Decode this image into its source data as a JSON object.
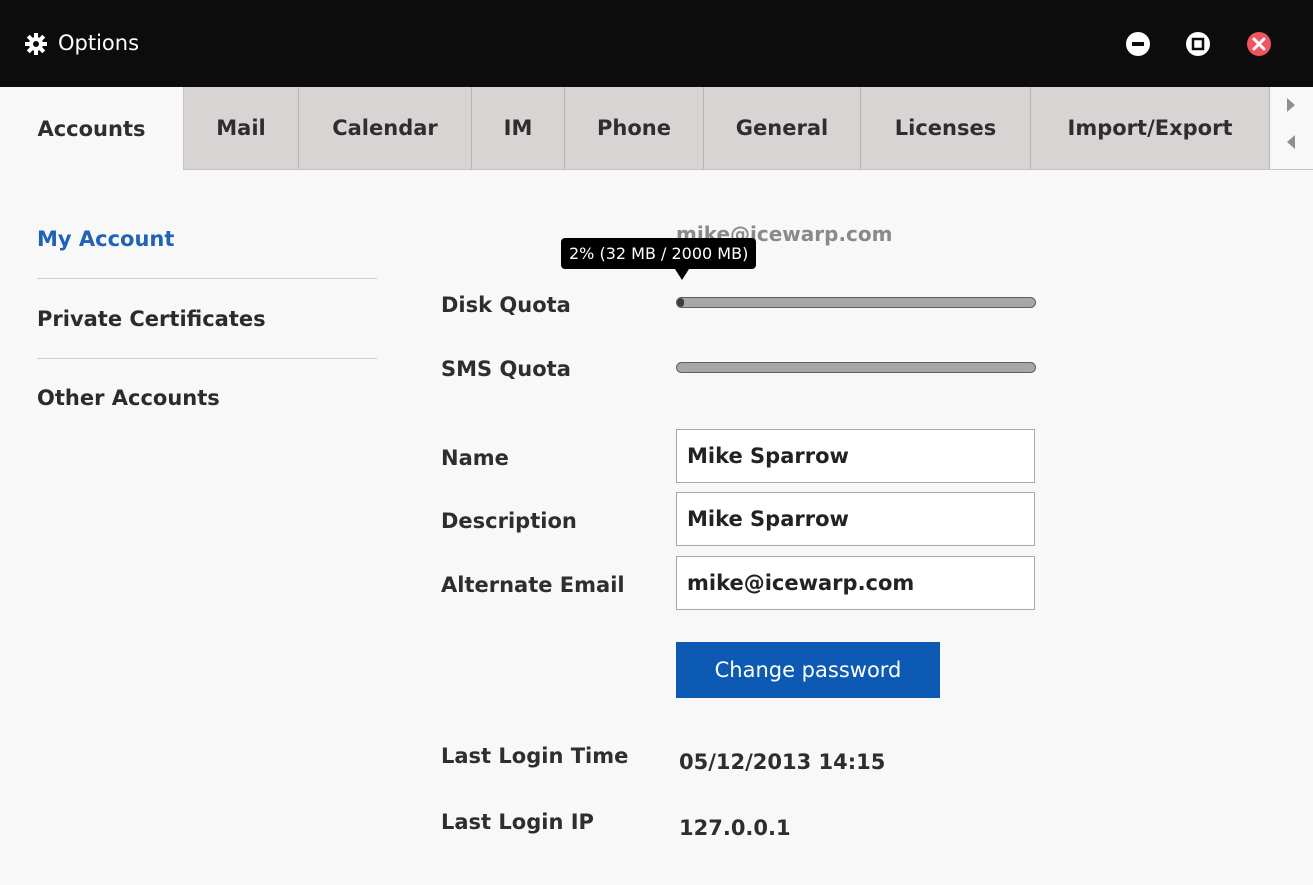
{
  "window": {
    "title": "Options",
    "icon": "gear-icon",
    "controls": [
      "minimize-icon",
      "maximize-icon",
      "close-icon"
    ],
    "close_color": "#f0545e"
  },
  "tabs": [
    {
      "label": "Accounts",
      "active": true
    },
    {
      "label": "Mail"
    },
    {
      "label": "Calendar"
    },
    {
      "label": "IM"
    },
    {
      "label": "Phone"
    },
    {
      "label": "General"
    },
    {
      "label": "Licenses"
    },
    {
      "label": "Import/Export"
    }
  ],
  "sidebar": {
    "items": [
      {
        "label": "My Account",
        "active": true
      },
      {
        "label": "Private Certificates"
      },
      {
        "label": "Other Accounts"
      }
    ]
  },
  "account": {
    "email_heading": "mike@icewarp.com",
    "disk_quota": {
      "label": "Disk Quota",
      "tooltip": "2% (32 MB / 2000 MB)",
      "used_fraction": 0.02
    },
    "sms_quota": {
      "label": "SMS Quota",
      "used_fraction": 0
    },
    "fields": {
      "name": {
        "label": "Name",
        "value": "Mike Sparrow"
      },
      "description": {
        "label": "Description",
        "value": "Mike Sparrow"
      },
      "alternate_email": {
        "label": "Alternate Email",
        "value": "mike@icewarp.com"
      }
    },
    "change_password_label": "Change password",
    "last_login_time": {
      "label": "Last Login Time",
      "value": "05/12/2013 14:15"
    },
    "last_login_ip": {
      "label": "Last Login IP",
      "value": "127.0.0.1"
    }
  },
  "colors": {
    "accent_blue": "#0c5ab3",
    "active_link": "#1f62b6",
    "titlebar": "#0c0c0c"
  }
}
